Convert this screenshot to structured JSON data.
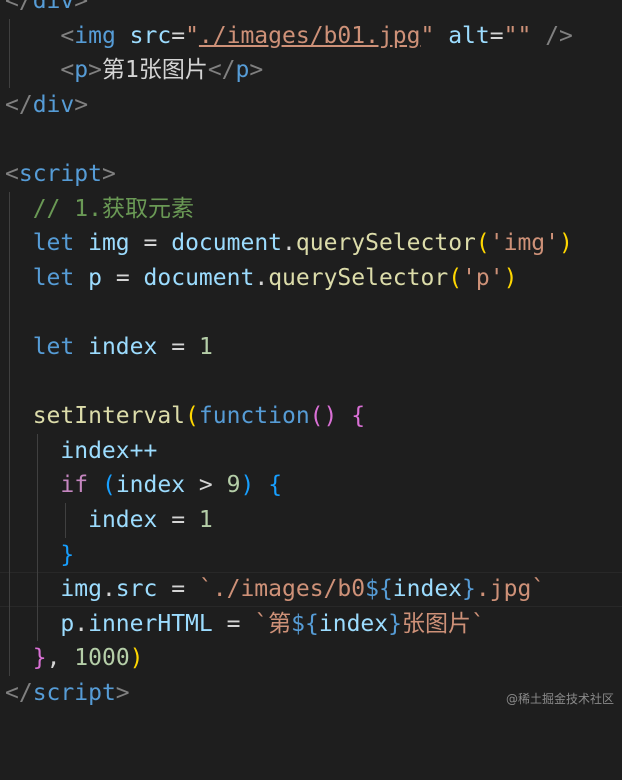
{
  "code": {
    "l1": {
      "tag": "div"
    },
    "l2": {
      "tag": "img",
      "attr_src": "src",
      "src_value": "./images/b01.jpg",
      "attr_alt": "alt",
      "alt_value": ""
    },
    "l3": {
      "tag": "p",
      "text": "第1张图片"
    },
    "l4": {
      "tag": "div"
    },
    "l6": {
      "tag": "script"
    },
    "l7": {
      "comment": "// 1.获取元素"
    },
    "l8": {
      "kw": "let",
      "var": "img",
      "obj": "document",
      "method": "querySelector",
      "arg": "'img'"
    },
    "l9": {
      "kw": "let",
      "var": "p",
      "obj": "document",
      "method": "querySelector",
      "arg": "'p'"
    },
    "l11": {
      "kw": "let",
      "var": "index",
      "value": "1"
    },
    "l13": {
      "fn": "setInterval",
      "kw": "function"
    },
    "l14": {
      "text": "index++"
    },
    "l15": {
      "kw": "if",
      "var": "index",
      "value": "9"
    },
    "l16": {
      "var": "index",
      "value": "1"
    },
    "l18": {
      "obj": "img",
      "prop": "src",
      "tpl_start": "`./images/b0",
      "tpl_var": "index",
      "tpl_end": ".jpg`"
    },
    "l19": {
      "obj": "p",
      "prop": "innerHTML",
      "tpl_start": "`第",
      "tpl_var": "index",
      "tpl_end": "张图片`"
    },
    "l20": {
      "value": "1000"
    },
    "l21": {
      "tag": "script"
    }
  },
  "watermark": "@稀土掘金技术社区"
}
